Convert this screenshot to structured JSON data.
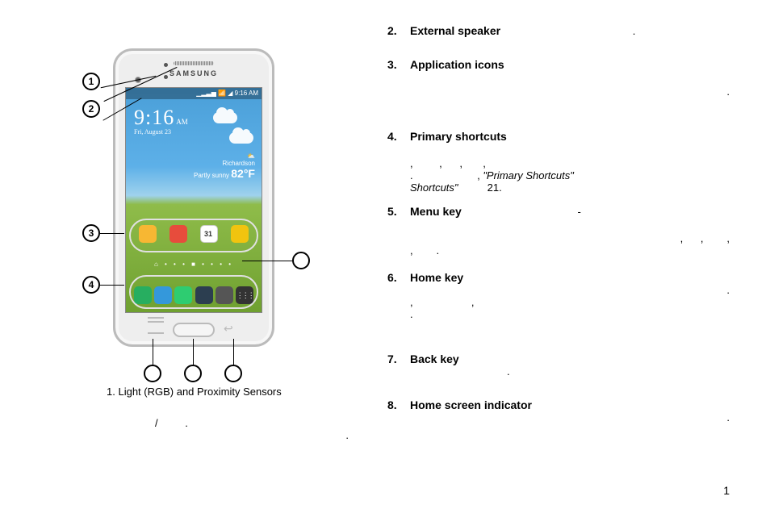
{
  "phone": {
    "brand": "SAMSUNG",
    "status_right": "▁▂▃▅ 📶 ◢ 9:16 AM",
    "clock_time": "9:16",
    "clock_ampm": "AM",
    "clock_date": "Fri, August 23",
    "weather_loc": "Richardson",
    "weather_cond": "Partly sunny",
    "weather_temp": "82°F",
    "weather_icon": "⛅",
    "indicator": "⌂ • • • ■ • • • •"
  },
  "callouts": {
    "c1": "1",
    "c2": "2",
    "c3": "3",
    "c4": "4"
  },
  "left_item": {
    "num": "1.",
    "term": "Light (RGB) and Proximity Sensors",
    "sep": "/",
    "period": "."
  },
  "right_items": [
    {
      "num": "2.",
      "term": "External speaker",
      "tail": "."
    },
    {
      "num": "3.",
      "term": "Application icons",
      "tail": "."
    },
    {
      "num": "4.",
      "term": "Primary shortcuts",
      "mid": ",         ,      ,       ,",
      "tail2": ".                      ,",
      "ref": "\"Primary Shortcuts\"",
      "ref_tail": "          21."
    },
    {
      "num": "5.",
      "term": "Menu key",
      "dash": "-",
      "mid": ",      ,        ,",
      "tail2": ",        ."
    },
    {
      "num": "6.",
      "term": "Home key",
      "tail": ".",
      "mid": ",                    ,",
      "tail2": "."
    },
    {
      "num": "7.",
      "term": "Back key",
      "tail": "."
    },
    {
      "num": "8.",
      "term": "Home screen indicator",
      "tail": "."
    }
  ],
  "page_number": "1"
}
